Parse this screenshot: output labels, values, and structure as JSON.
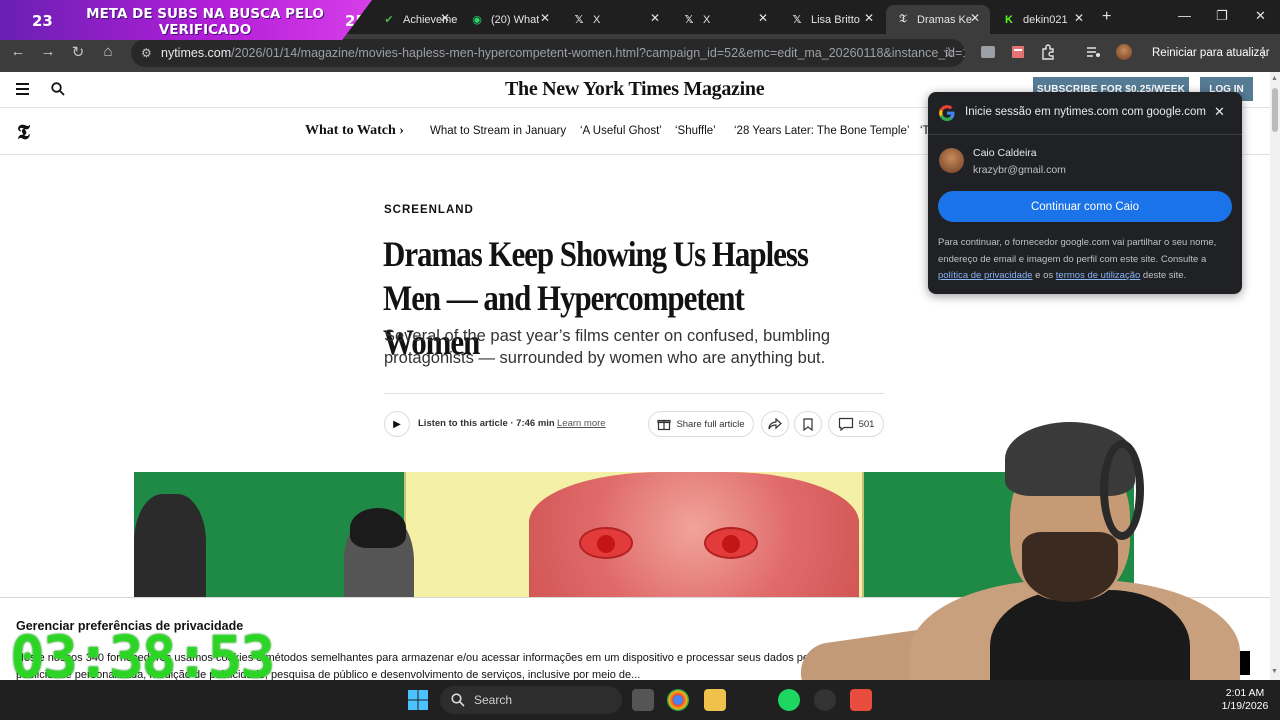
{
  "overlay": {
    "banner_left_num": "23",
    "banner_text": "META DE SUBS NA BUSCA PELO VERIFICADO",
    "banner_right_num": "25",
    "clock": "03:38:53"
  },
  "browser": {
    "tabs": [
      {
        "label": "Achieveme",
        "icon": "achievement-icon",
        "active": false
      },
      {
        "label": "(20) What",
        "icon": "whatsapp-icon",
        "active": false
      },
      {
        "label": "X",
        "icon": "x-icon",
        "active": false
      },
      {
        "label": "X",
        "icon": "x-icon",
        "active": false
      },
      {
        "label": "Lisa Britto",
        "icon": "x-icon",
        "active": false
      },
      {
        "label": "Dramas Ke",
        "icon": "nyt-icon",
        "active": true
      },
      {
        "label": "dekin021",
        "icon": "kick-icon",
        "active": false
      }
    ],
    "url_host": "nytimes.com",
    "url_path": "/2026/01/14/magazine/movies-hapless-men-hypercompetent-women.html?campaign_id=52&emc=edit_ma_20260118&instance_id=1...",
    "restart_label": "Reiniciar para atualizar"
  },
  "nyt": {
    "logo": "The New York Times Magazine",
    "subscribe_label": "SUBSCRIBE FOR $0.25/WEEK",
    "login_label": "LOG IN",
    "what_to_watch": "What to Watch ›",
    "subnav": [
      "What to Stream in January",
      "‘A Useful Ghost’",
      "‘Shuffle’",
      "‘28 Years Later: The Bone Temple’",
      "‘T"
    ],
    "kicker": "SCREENLAND",
    "headline": "Dramas Keep Showing Us Hapless Men — and Hypercompetent Women",
    "summary": "Several of the past year’s films center on confused, bumbling protagonists — surrounded by women who are anything but.",
    "listen_label": "Listen to this article · 7:46 min",
    "learn_more": "Learn more",
    "share_full": "Share full article",
    "comments_count": "501"
  },
  "privacy": {
    "title": "Gerenciar preferências de privacidade",
    "body": "Nós e nossos 340 fornecedores usamos cookies e métodos semelhantes para armazenar e/ou acessar informações em um dispositivo e processar seus dados pessoais (dados de navegação) para publicidade personalizada, medição de publicidade, pesquisa de público e desenvolvimento de serviços, inclusive por meio de..."
  },
  "google_popup": {
    "title": "Inicie sessão em nytimes.com com google.com",
    "name": "Caio Caldeira",
    "email": "krazybr@gmail.com",
    "continue_label": "Continuar como Caio",
    "fine_print_1": "Para continuar, o fornecedor google.com vai partilhar o seu nome, endereço de email e imagem do perfil com este site. Consulte a ",
    "privacy_link": "política de privacidade",
    "fine_print_2": " e os ",
    "terms_link": "termos de utilização",
    "fine_print_3": " deste site."
  },
  "taskbar": {
    "search_placeholder": "Search",
    "time": "2:01 AM",
    "date": "1/19/2026"
  },
  "colors": {
    "nyt_button": "#567b95",
    "google_blue": "#1a73e8",
    "overlay_purple": "#b51fd9",
    "clock_green": "#30dc28"
  }
}
